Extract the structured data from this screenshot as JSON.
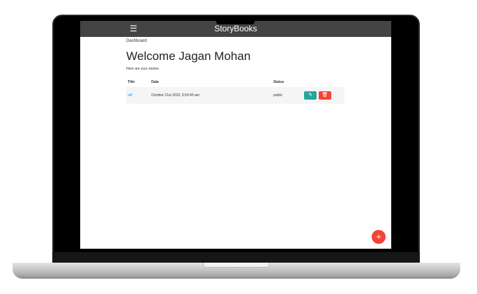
{
  "navbar": {
    "menu_icon": "☰",
    "brand": "StoryBooks"
  },
  "breadcrumb": "Dashboard",
  "title": "Welcome Jagan Mohan",
  "subtitle": "Here are your stories",
  "table": {
    "headers": [
      "Title",
      "Date",
      "Status"
    ],
    "rows": [
      {
        "title": "sdf",
        "date": "October 21st 2023, 9:53:45 am",
        "status": "public"
      }
    ]
  },
  "colors": {
    "edit": "#26a69a",
    "delete": "#f44336",
    "navbar": "#444444"
  },
  "fab": "+"
}
